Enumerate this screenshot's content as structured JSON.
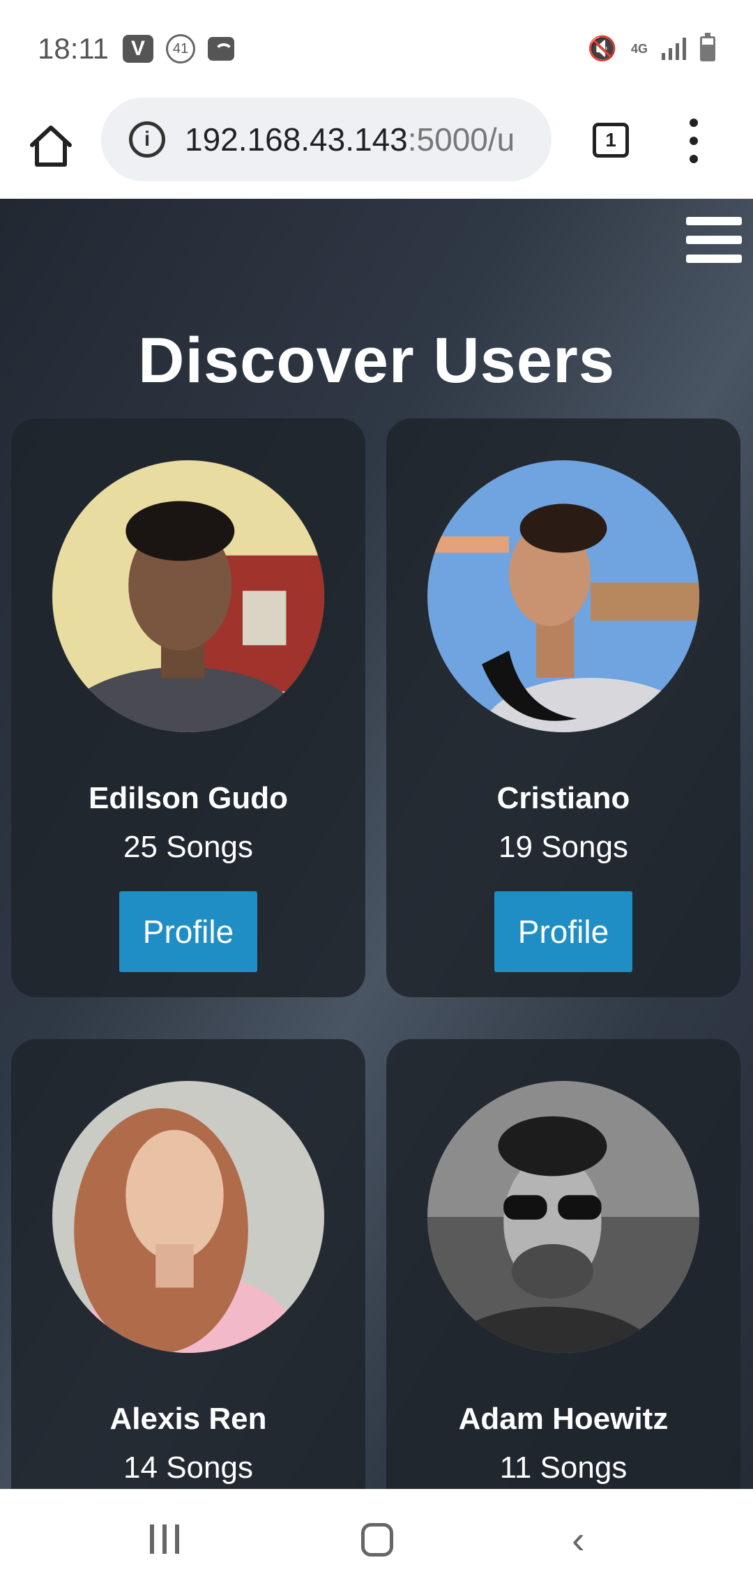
{
  "status_bar": {
    "time": "18:11",
    "vivo_badge": "V",
    "notification_count": "41",
    "network_type": "4G"
  },
  "browser": {
    "url_host": "192.168.43.143",
    "url_path": ":5000/u",
    "tab_count": "1"
  },
  "page": {
    "title": "Discover Users",
    "profile_label": "Profile",
    "users": [
      {
        "name": "Edilson Gudo",
        "songs": "25 Songs"
      },
      {
        "name": "Cristiano",
        "songs": "19 Songs"
      },
      {
        "name": "Alexis Ren",
        "songs": "14 Songs"
      },
      {
        "name": "Adam Hoewitz",
        "songs": "11 Songs"
      }
    ]
  },
  "colors": {
    "accent_button": "#1f8ec4",
    "card_background": "#1e242c",
    "page_background": "#2f3845"
  },
  "icons": [
    "home-icon",
    "info-icon",
    "tabs-icon",
    "overflow-menu-icon",
    "hamburger-menu-icon",
    "recents-icon",
    "home-nav-icon",
    "back-icon"
  ]
}
